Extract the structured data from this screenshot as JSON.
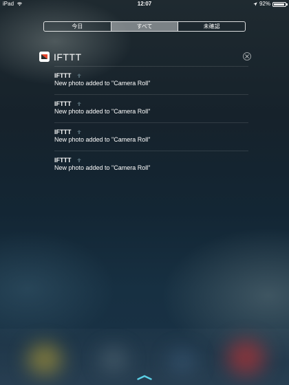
{
  "status_bar": {
    "device": "iPad",
    "time": "12:07",
    "battery_percent": "92%",
    "battery_level": 0.92
  },
  "segments": {
    "items": [
      {
        "label": "今日",
        "selected": false
      },
      {
        "label": "すべて",
        "selected": true
      },
      {
        "label": "未確認",
        "selected": false
      }
    ]
  },
  "notification_group": {
    "app_name": "IFTTT",
    "items": [
      {
        "title": "IFTTT",
        "body": "New photo added to \"Camera Roll\""
      },
      {
        "title": "IFTTT",
        "body": "New photo added to \"Camera Roll\""
      },
      {
        "title": "IFTTT",
        "body": "New photo added to \"Camera Roll\""
      },
      {
        "title": "IFTTT",
        "body": "New photo added to \"Camera Roll\""
      }
    ]
  },
  "colors": {
    "background_top": "#1f2a30",
    "background_bottom": "#1a3246",
    "ifttt_logo_red": "#e8452c",
    "ifttt_logo_dark": "#2a2a2a"
  },
  "icons": {
    "wifi": "wifi-icon",
    "location": "location-arrow-icon",
    "battery": "battery-icon",
    "close": "close-icon",
    "grabber": "chevron-up-icon"
  }
}
